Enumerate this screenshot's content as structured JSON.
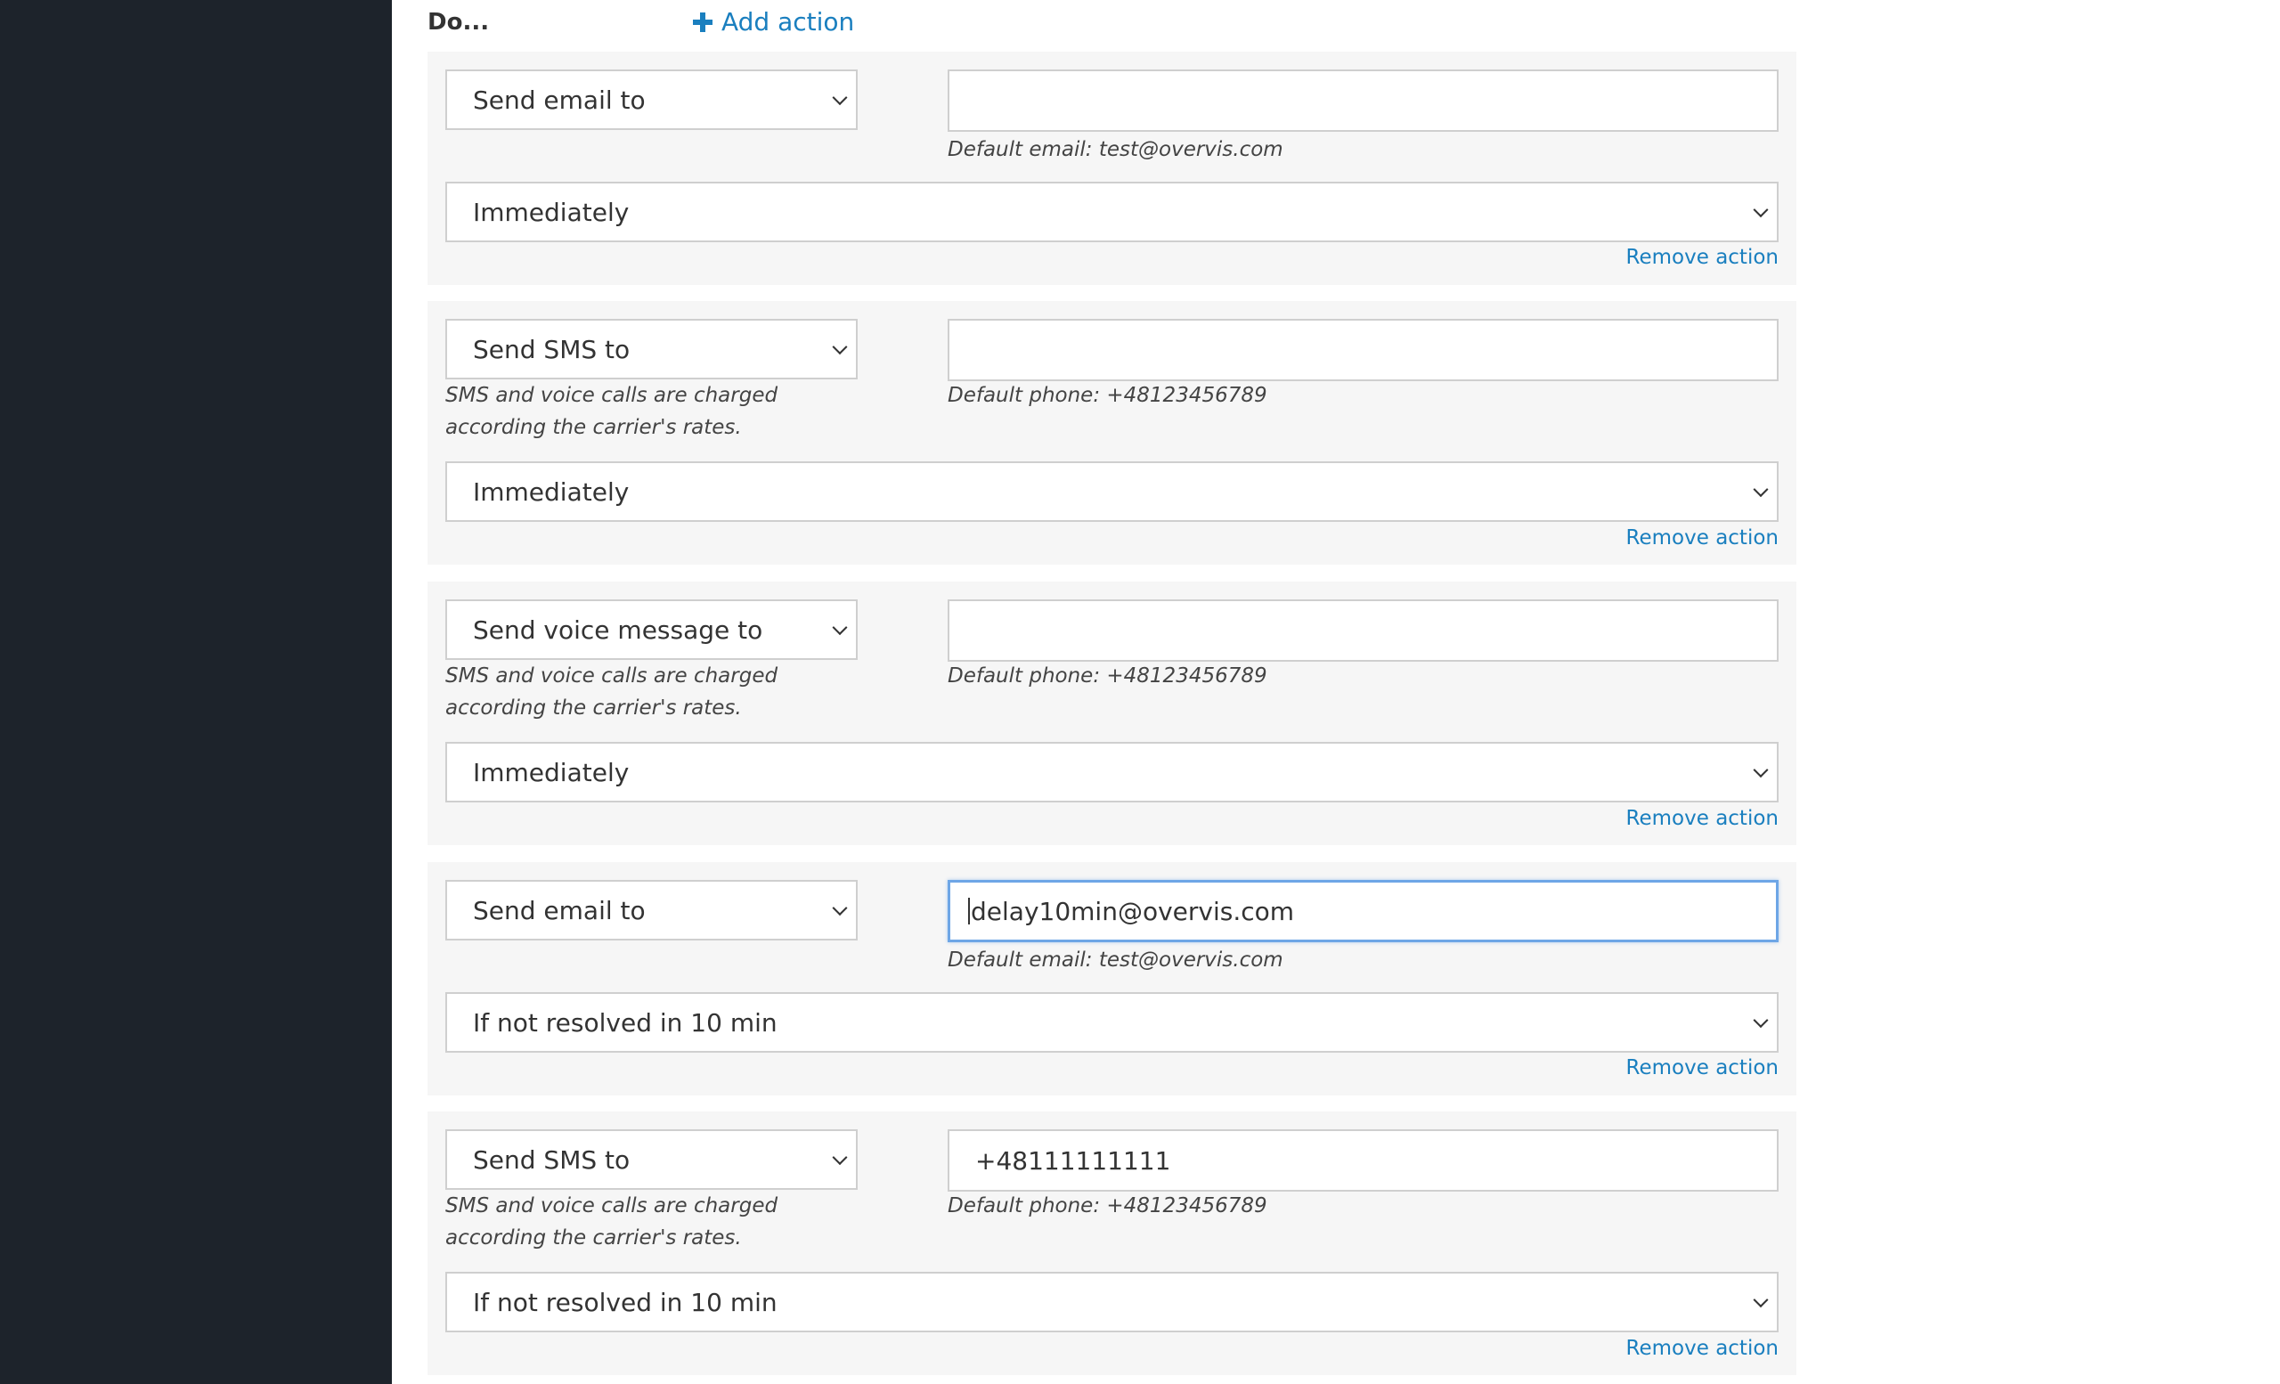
{
  "header": {
    "do_label": "Do...",
    "add_action_label": "Add action"
  },
  "actions": [
    {
      "type": "Send email to",
      "target_value": "",
      "default_hint": "Default email: test@overvis.com",
      "charge_note": "",
      "timing": "Immediately",
      "remove_label": "Remove action"
    },
    {
      "type": "Send SMS to",
      "target_value": "",
      "default_hint": "Default phone: +48123456789",
      "charge_note": "SMS and voice calls are charged according the carrier's rates.",
      "timing": "Immediately",
      "remove_label": "Remove action"
    },
    {
      "type": "Send voice message to",
      "target_value": "",
      "default_hint": "Default phone: +48123456789",
      "charge_note": "SMS and voice calls are charged according the carrier's rates.",
      "timing": "Immediately",
      "remove_label": "Remove action"
    },
    {
      "type": "Send email to",
      "target_value": "delay10min@overvis.com",
      "default_hint": "Default email: test@overvis.com",
      "charge_note": "",
      "timing": "If not resolved in 10 min",
      "remove_label": "Remove action"
    },
    {
      "type": "Send SMS to",
      "target_value": "+48111111111",
      "default_hint": "Default phone: +48123456789",
      "charge_note": "SMS and voice calls are charged according the carrier's rates.",
      "timing": "If not resolved in 10 min",
      "remove_label": "Remove action"
    }
  ],
  "colors": {
    "sidebar": "#1d232b",
    "accent": "#1a7fbf",
    "card": "#f6f6f6"
  }
}
